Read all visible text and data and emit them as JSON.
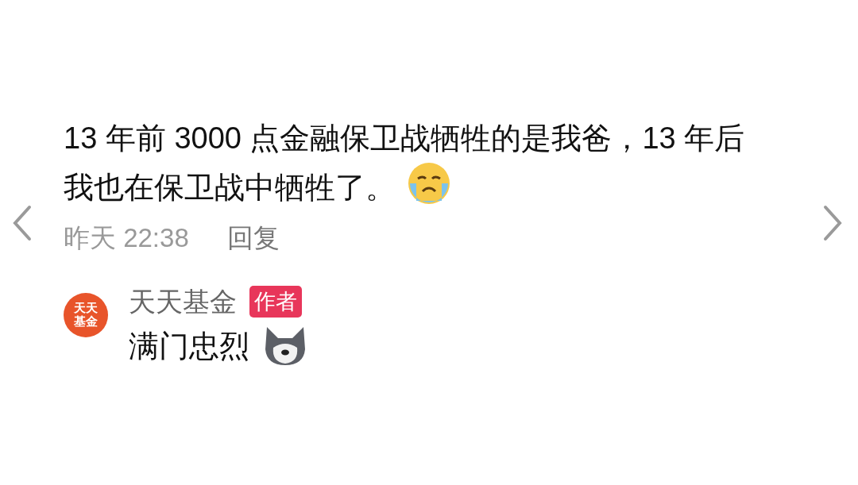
{
  "comment": {
    "text": "13 年前 3000 点金融保卫战牺牲的是我爸，13 年后我也在保卫战中牺牲了。",
    "time": "昨天 22:38",
    "reply_action": "回复"
  },
  "reply": {
    "avatar_text": [
      "天天",
      "基金"
    ],
    "author": "天天基金",
    "badge": "作者",
    "text": "满门忠烈"
  }
}
